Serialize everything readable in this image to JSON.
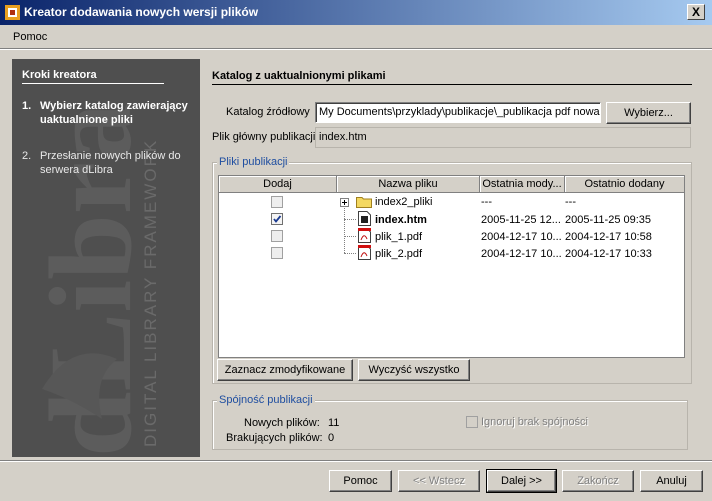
{
  "window": {
    "title": "Kreator dodawania nowych wersji plików",
    "close_label": "X"
  },
  "menu": {
    "items": [
      "Pomoc"
    ]
  },
  "wizard": {
    "steps_title": "Kroki kreatora",
    "logo_main": "dLibra",
    "logo_sub": "DIGITAL LIBRARY FRAMEWORK",
    "steps": [
      {
        "num": "1.",
        "label": "Wybierz katalog zawierający uaktualnione pliki"
      },
      {
        "num": "2.",
        "label": "Przesłanie nowych plików do serwera dLibra"
      }
    ]
  },
  "panel": {
    "title": "Katalog z uaktualnionymi plikami",
    "source_label": "Katalog źródłowy",
    "source_value": "My Documents\\przyklady\\publikacje\\_publikacja pdf nowa",
    "browse_button": "Wybierz...",
    "main_file_label": "Plik główny publikacji",
    "main_file_value": "index.htm"
  },
  "files_group": {
    "title": "Pliki publikacji",
    "columns": [
      "Dodaj",
      "Nazwa pliku",
      "Ostatnia mody...",
      "Ostatnio dodany"
    ],
    "rows": [
      {
        "checked": false,
        "name": "index2_pliki",
        "type": "folder",
        "modified": "---",
        "added": "---",
        "bold": false
      },
      {
        "checked": true,
        "name": "index.htm",
        "type": "html",
        "modified": "2005-11-25 12...",
        "added": "2005-11-25 09:35",
        "bold": true
      },
      {
        "checked": false,
        "name": "plik_1.pdf",
        "type": "pdf",
        "modified": "2004-12-17 10...",
        "added": "2004-12-17 10:58",
        "bold": false
      },
      {
        "checked": false,
        "name": "plik_2.pdf",
        "type": "pdf",
        "modified": "2004-12-17 10...",
        "added": "2004-12-17 10:33",
        "bold": false
      }
    ],
    "mark_modified_button": "Zaznacz zmodyfikowane",
    "clear_all_button": "Wyczyść wszystko"
  },
  "consistency": {
    "title": "Spójność publikacji",
    "new_files_label": "Nowych plików:",
    "new_files_value": "11",
    "missing_files_label": "Brakujących plików:",
    "missing_files_value": "0",
    "ignore_label": "Ignoruj brak spójności"
  },
  "footer": {
    "help": "Pomoc",
    "back": "<< Wstecz",
    "next": "Dalej >>",
    "finish": "Zakończ",
    "cancel": "Anuluj"
  }
}
